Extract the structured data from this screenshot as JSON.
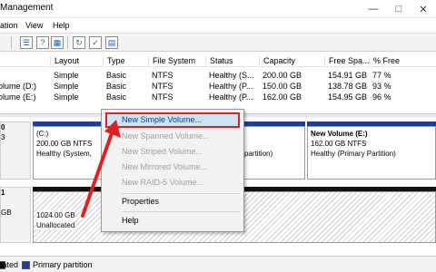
{
  "window": {
    "title": "Management"
  },
  "menubar": {
    "items": [
      "ation",
      "View",
      "Help"
    ]
  },
  "volume_list": {
    "columns": [
      "Layout",
      "Type",
      "File System",
      "Status",
      "Capacity",
      "Free Spa...",
      "% Free"
    ],
    "rows": [
      {
        "volume": "",
        "layout": "Simple",
        "type": "Basic",
        "fs": "NTFS",
        "status": "Healthy (S...",
        "capacity": "200.00 GB",
        "free": "154.91 GB",
        "pct": "77 %"
      },
      {
        "volume": "olume (D:)",
        "layout": "Simple",
        "type": "Basic",
        "fs": "NTFS",
        "status": "Healthy (P...",
        "capacity": "150.00 GB",
        "free": "138.78 GB",
        "pct": "93 %"
      },
      {
        "volume": "olume (E:)",
        "layout": "Simple",
        "type": "Basic",
        "fs": "NTFS",
        "status": "Healthy (P...",
        "capacity": "162.00 GB",
        "free": "154.95 GB",
        "pct": "96 %"
      }
    ]
  },
  "disks": [
    {
      "info": [
        "0",
        "",
        "3"
      ],
      "partitions": [
        {
          "name": "(C:)",
          "size": "200.00 GB NTFS",
          "status": "Healthy (System,"
        },
        {
          "name": "",
          "size": "",
          "status": "partition)"
        },
        {
          "name": "New Volume  (E:)",
          "size": "162.00 GB NTFS",
          "status": "Healthy (Primary Partition)"
        }
      ]
    },
    {
      "info": [
        "1",
        "",
        "GB"
      ],
      "partitions": [
        {
          "size": "1024.00 GB",
          "status": "Unallocated"
        }
      ]
    }
  ],
  "legend": {
    "items": [
      "cated",
      "Primary partition"
    ],
    "colors": [
      "#111111",
      "#1f3d99"
    ]
  },
  "context_menu": {
    "items": [
      "New Simple Volume...",
      "New Spanned Volume...",
      "New Striped Volume...",
      "New Mirrored Volume...",
      "New RAID-5 Volume...",
      "Properties",
      "Help"
    ],
    "highlight_color": "#e02020"
  }
}
